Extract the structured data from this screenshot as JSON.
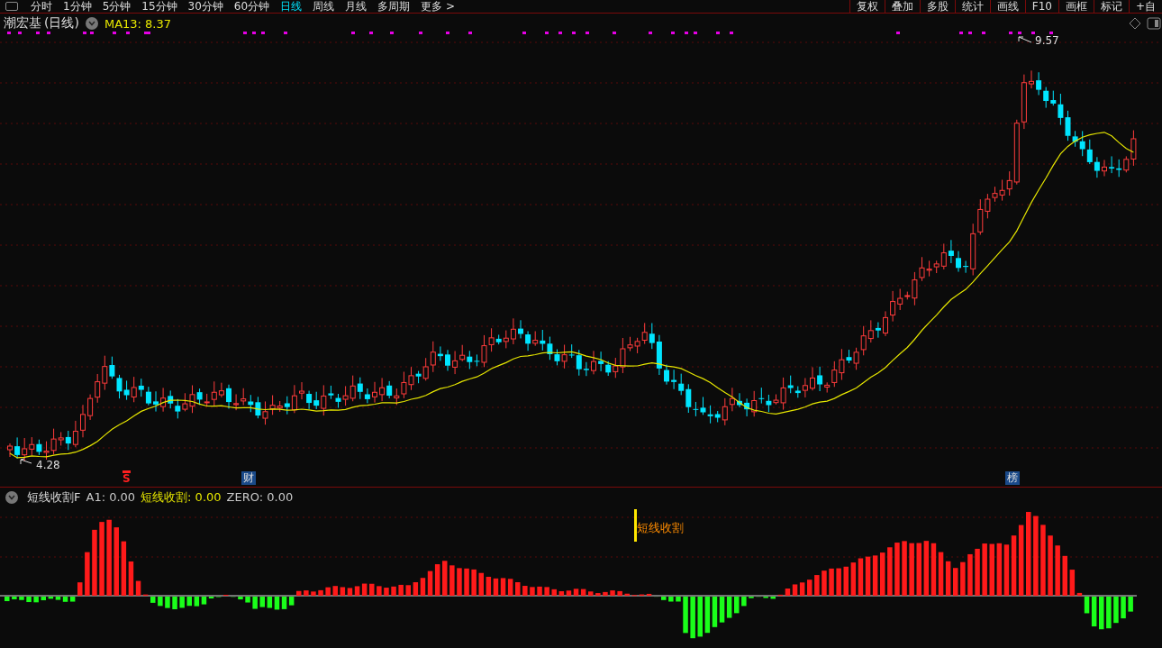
{
  "toolbar": {
    "tabs": [
      {
        "label": "分时",
        "selected": false
      },
      {
        "label": "1分钟",
        "selected": false
      },
      {
        "label": "5分钟",
        "selected": false
      },
      {
        "label": "15分钟",
        "selected": false
      },
      {
        "label": "30分钟",
        "selected": false
      },
      {
        "label": "60分钟",
        "selected": false
      },
      {
        "label": "日线",
        "selected": true
      },
      {
        "label": "周线",
        "selected": false
      },
      {
        "label": "月线",
        "selected": false
      },
      {
        "label": "多周期",
        "selected": false
      },
      {
        "label": "更多 >",
        "selected": false
      }
    ],
    "tools": [
      "复权",
      "叠加",
      "多股",
      "统计",
      "画线",
      "F10",
      "画框",
      "标记",
      "+自"
    ]
  },
  "price_panel": {
    "stock": "潮宏基",
    "period": "(日线)",
    "ma_label": "MA13: 8.37",
    "high_label": "9.57",
    "low_label": "4.28",
    "markers": [
      {
        "kind": "arrow",
        "text": "S"
      },
      {
        "kind": "badge",
        "text": "财"
      },
      {
        "kind": "badge",
        "text": "榜"
      }
    ]
  },
  "indicator_panel": {
    "name": "短线收割F",
    "values": [
      {
        "text": "A1: 0.00",
        "color": "#c8c8c8"
      },
      {
        "text": "短线收割: 0.00",
        "color": "#e6e600"
      },
      {
        "text": "ZERO: 0.00",
        "color": "#c8c8c8"
      }
    ],
    "signal_label": "短线收割"
  }
}
